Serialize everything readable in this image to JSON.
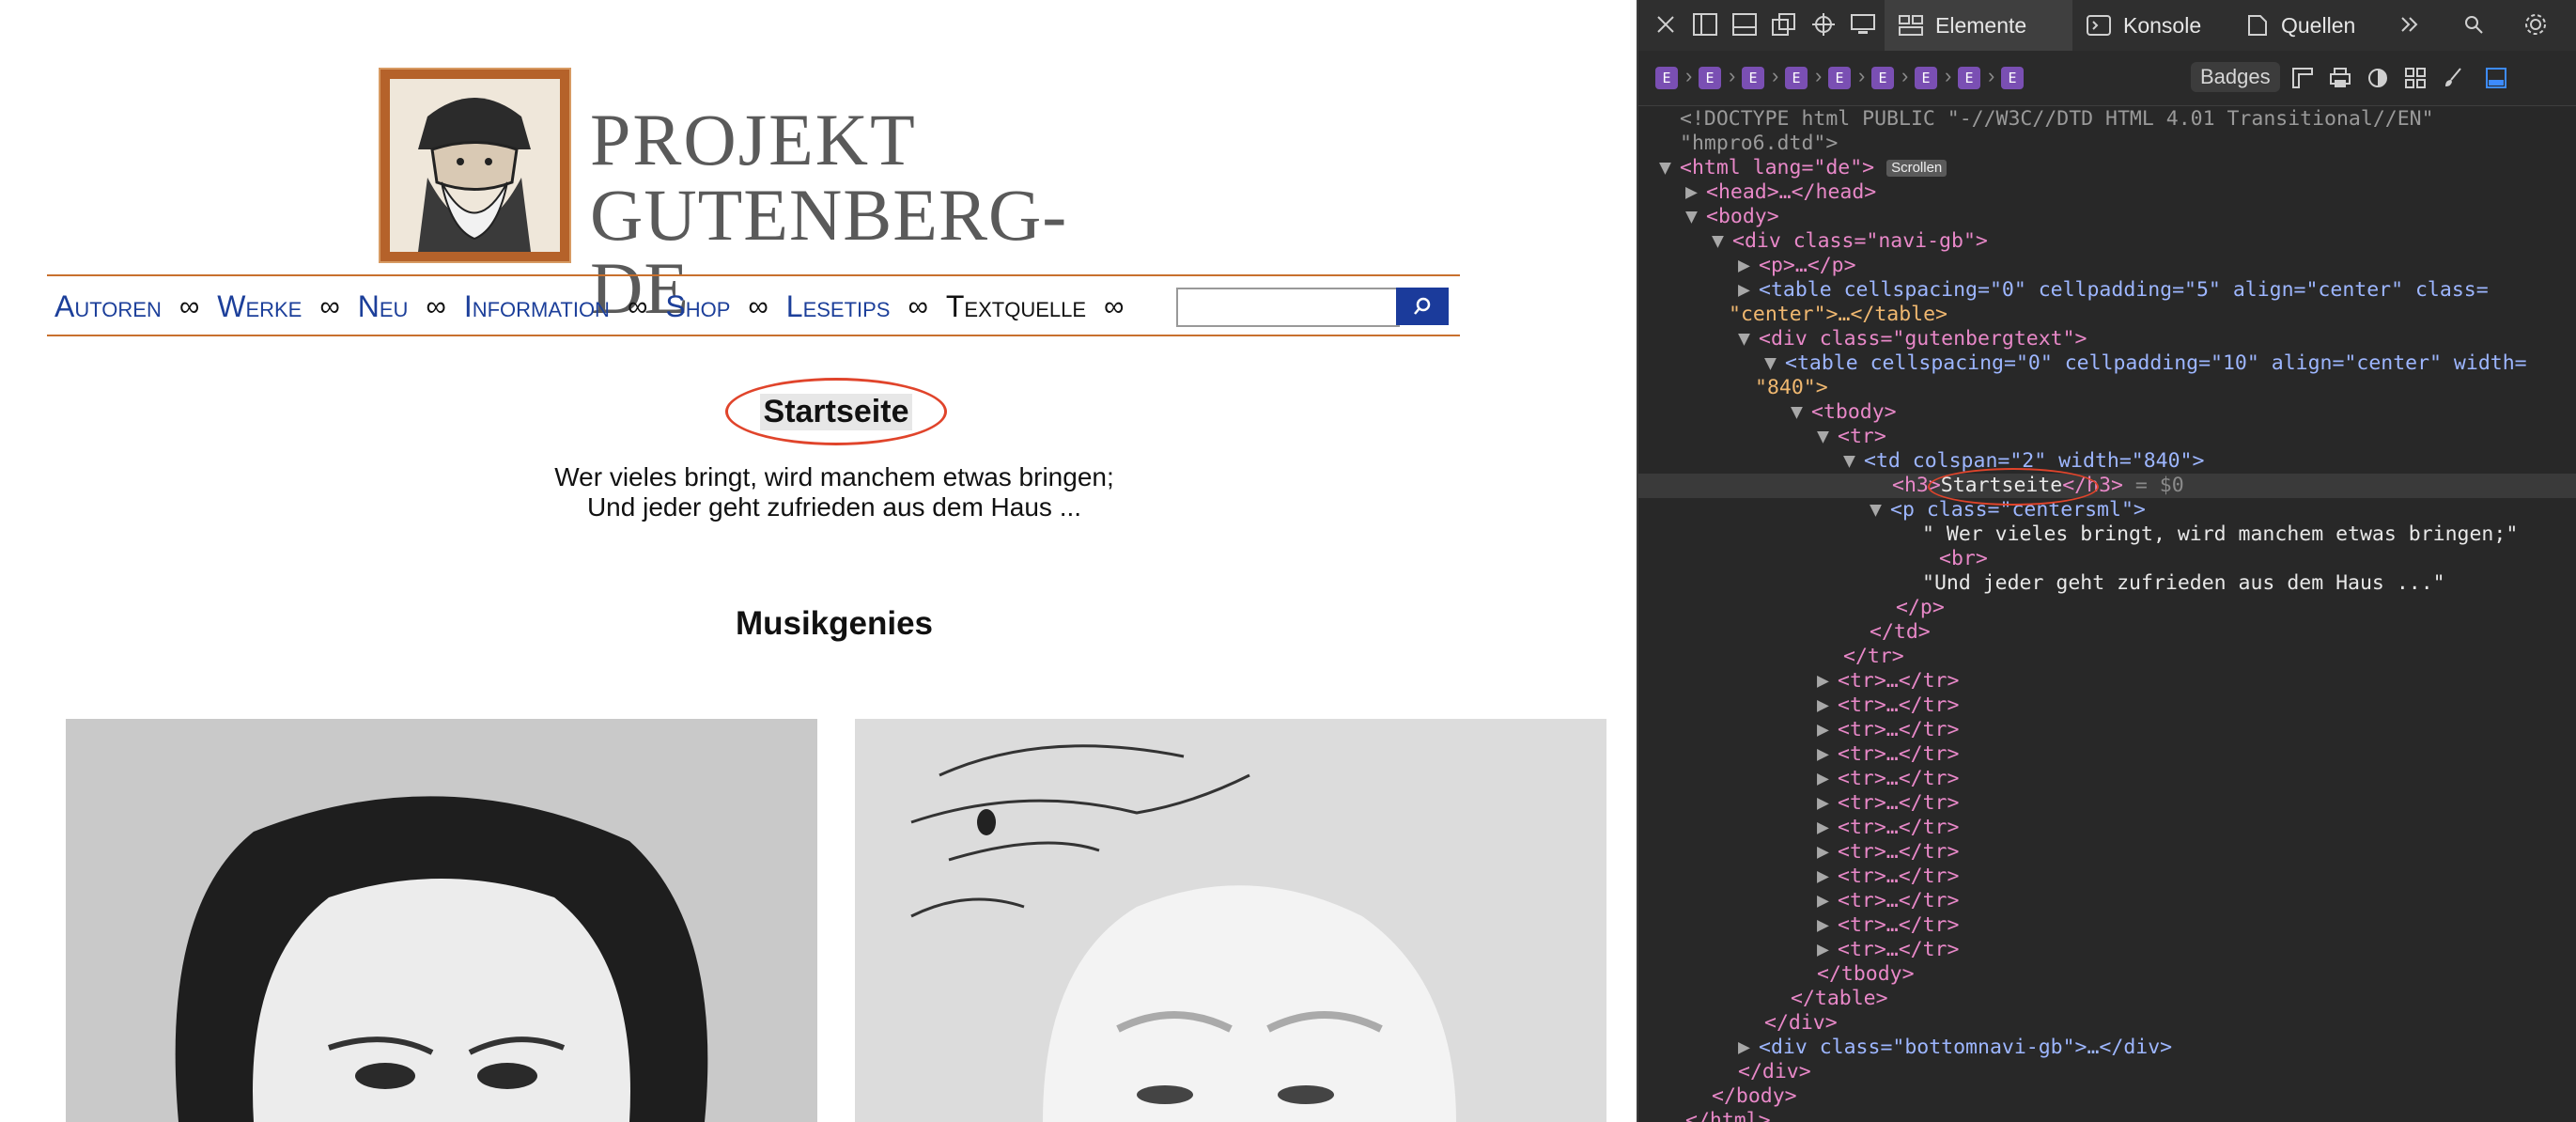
{
  "logo": {
    "line1": "PROJEKT",
    "line2": "GUTENBERG-DE"
  },
  "nav": {
    "items": [
      "Autoren",
      "Werke",
      "Neu",
      "Information",
      "Shop",
      "Lesetips",
      "Textquelle"
    ],
    "separator": "∞",
    "search_placeholder": ""
  },
  "content": {
    "heading": "Startseite",
    "quote_line1": "Wer vieles bringt, wird manchem etwas bringen;",
    "quote_line2": "Und jeder geht zufrieden aus dem Haus ...",
    "section_title": "Musikgenies"
  },
  "devtools": {
    "tabs": {
      "elements": "Elemente",
      "console": "Konsole",
      "sources": "Quellen"
    },
    "badges_label": "Badges",
    "crumb_badge": "E",
    "scroll_badge": "Scrollen",
    "tree": {
      "doctype_1": "<!DOCTYPE html PUBLIC \"-//W3C//DTD HTML 4.01 Transitional//EN\"",
      "doctype_2": "\"hmpro6.dtd\">",
      "html_open": "<html lang=\"de\">",
      "head": "<head>…</head>",
      "body_open": "<body>",
      "div_navi": "<div class=\"navi-gb\">",
      "p_collapsed": "<p>…</p>",
      "table_center_1": "<table cellspacing=\"0\" cellpadding=\"5\" align=\"center\" class=",
      "table_center_2": "\"center\">…</table>",
      "div_gtext": "<div class=\"gutenbergtext\">",
      "table_840_1": "<table cellspacing=\"0\" cellpadding=\"10\" align=\"center\" width=",
      "table_840_2": "\"840\">",
      "tbody_open": "<tbody>",
      "tr_open": "<tr>",
      "td_open": "<td colspan=\"2\" width=\"840\">",
      "h3_open": "<h3>",
      "h3_text": "Startseite",
      "h3_close": "</h3>",
      "h3_suffix": " = $0",
      "p_centersml": "<p class=\"centersml\">",
      "p_text1": "\" Wer vieles bringt, wird manchem etwas bringen;\"",
      "br": "<br>",
      "p_text2": "\"Und jeder geht zufrieden aus dem Haus ...\"",
      "p_close": "</p>",
      "td_close": "</td>",
      "tr_close": "</tr>",
      "tr_collapsed": "<tr>…</tr>",
      "tbody_close": "</tbody>",
      "table_close": "</table>",
      "div_close": "</div>",
      "div_bottomnavi": "<div class=\"bottomnavi-gb\">…</div>",
      "body_close": "</body>",
      "html_close": "</html>"
    }
  }
}
